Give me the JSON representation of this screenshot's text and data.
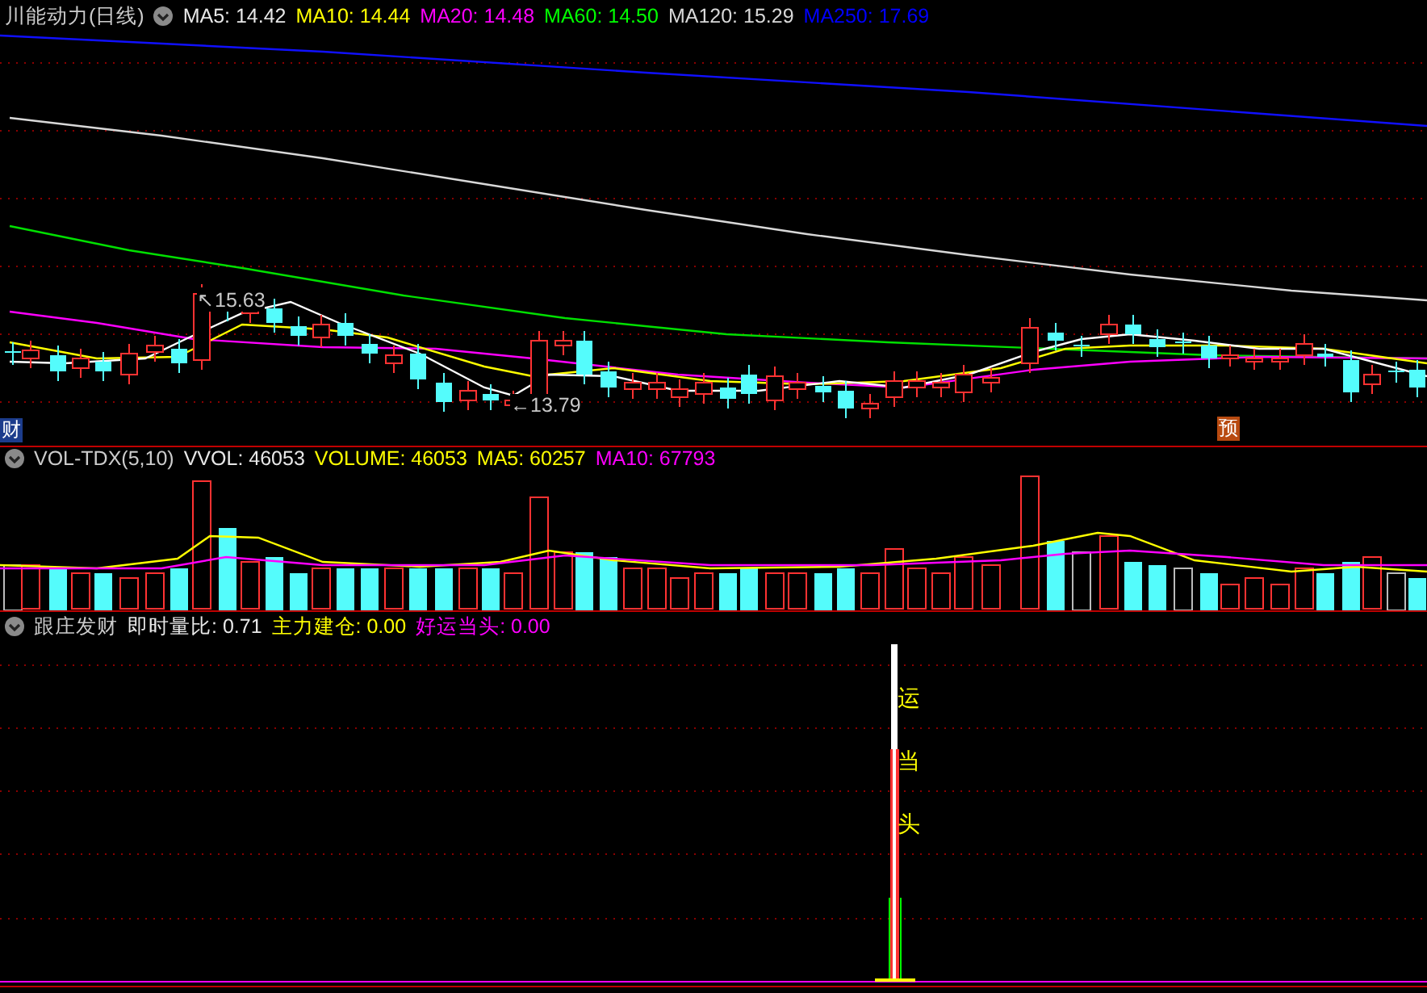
{
  "price_panel": {
    "title": "川能动力(日线)",
    "indicators": [
      {
        "label": "MA5: 14.42",
        "color": "#e8e8e8"
      },
      {
        "label": "MA10: 14.44",
        "color": "#ffff00"
      },
      {
        "label": "MA20: 14.48",
        "color": "#ff00ff"
      },
      {
        "label": "MA60: 14.50",
        "color": "#00ff00"
      },
      {
        "label": "MA120: 15.29",
        "color": "#d8d8d8"
      },
      {
        "label": "MA250: 17.69",
        "color": "#0000ff"
      }
    ],
    "annotations": [
      "↖15.63",
      "←13.79"
    ],
    "badges": [
      "财",
      "预"
    ]
  },
  "volume_panel": {
    "title": "VOL-TDX(5,10)",
    "indicators": [
      {
        "label": "VVOL: 46053",
        "color": "#e8e8e8"
      },
      {
        "label": "VOLUME: 46053",
        "color": "#ffff00"
      },
      {
        "label": "MA5: 60257",
        "color": "#ffff00"
      },
      {
        "label": "MA10: 67793",
        "color": "#ff00ff"
      }
    ]
  },
  "signal_panel": {
    "title": "跟庄发财",
    "indicators": [
      {
        "label": "即时量比: 0.71",
        "color": "#e8e8e8"
      },
      {
        "label": "主力建仓: 0.00",
        "color": "#ffff00"
      },
      {
        "label": "好运当头: 0.00",
        "color": "#ff00ff"
      }
    ],
    "vertical_label": "运当头"
  }
}
